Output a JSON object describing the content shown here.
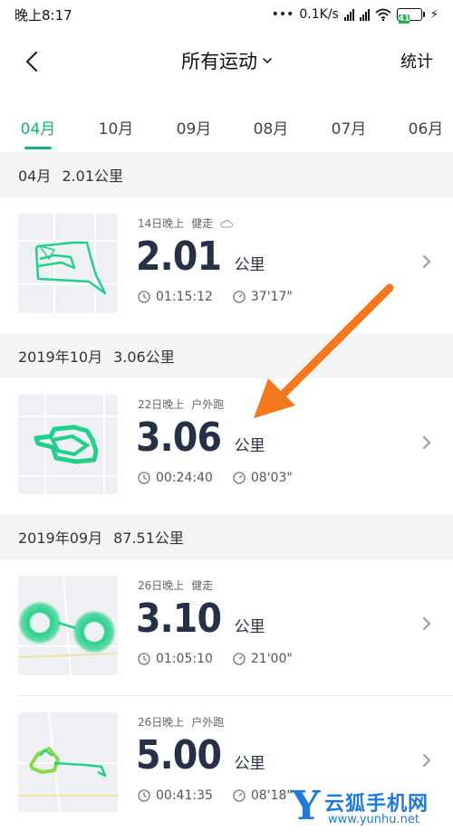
{
  "status_bar": {
    "time": "晚上8:17",
    "network_speed": "0.1K/s",
    "battery_level": "41"
  },
  "nav": {
    "title": "所有运动",
    "stats_label": "统计"
  },
  "tabs": [
    {
      "label": "04月",
      "active": true
    },
    {
      "label": "10月",
      "active": false
    },
    {
      "label": "09月",
      "active": false
    },
    {
      "label": "08月",
      "active": false
    },
    {
      "label": "07月",
      "active": false
    },
    {
      "label": "06月",
      "active": false
    }
  ],
  "sections": [
    {
      "period": "04月",
      "total": "2.01公里",
      "activities": [
        {
          "when": "14日晚上",
          "type": "健走",
          "distance": "2.01",
          "unit": "公里",
          "duration": "01:15:12",
          "pace": "37'17\"",
          "has_weather_icon": true
        }
      ]
    },
    {
      "period": "2019年10月",
      "total": "3.06公里",
      "activities": [
        {
          "when": "22日晚上",
          "type": "户外跑",
          "distance": "3.06",
          "unit": "公里",
          "duration": "00:24:40",
          "pace": "08'03\"",
          "has_weather_icon": false
        }
      ]
    },
    {
      "period": "2019年09月",
      "total": "87.51公里",
      "activities": [
        {
          "when": "26日晚上",
          "type": "健走",
          "distance": "3.10",
          "unit": "公里",
          "duration": "01:05:10",
          "pace": "21'00\"",
          "has_weather_icon": false
        },
        {
          "when": "26日晚上",
          "type": "户外跑",
          "distance": "5.00",
          "unit": "公里",
          "duration": "00:41:35",
          "pace": "08'18\"",
          "has_weather_icon": false
        }
      ]
    }
  ],
  "watermark": {
    "letter": "Y",
    "title": "云狐手机网",
    "url": "www.yunhu.net"
  },
  "colors": {
    "accent": "#18b07a",
    "route": "#22d08a",
    "distance_text": "#263147",
    "section_bg": "#f4f4f5",
    "arrow": "#f5781e",
    "watermark": "#1f7ad9"
  }
}
